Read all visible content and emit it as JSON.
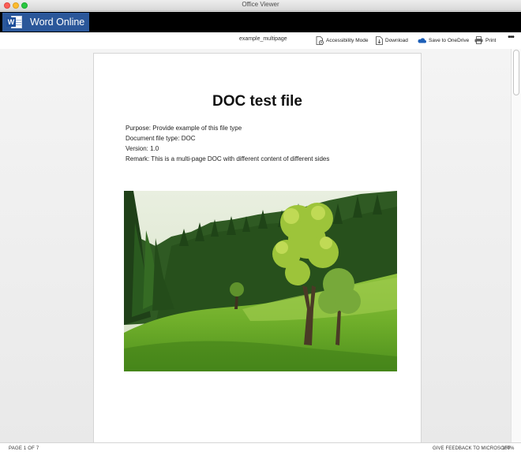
{
  "window": {
    "title": "Office Viewer"
  },
  "app": {
    "brand": "Word Online",
    "icon_letter": "W"
  },
  "toolbar": {
    "document_name": "example_multipage",
    "accessibility": "Accessibility Mode",
    "download": "Download",
    "save_onedrive": "Save to OneDrive",
    "print": "Print",
    "more": "•••"
  },
  "document": {
    "title": "DOC test file",
    "lines": [
      "Purpose: Provide example of this file type",
      "Document file type: DOC",
      "Version: 1.0",
      "Remark: This is a multi-page DOC with different content of different sides"
    ]
  },
  "status": {
    "page": "PAGE 1 OF 7",
    "feedback": "GIVE FEEDBACK TO MICROSOFT",
    "zoom": "100%"
  },
  "colors": {
    "brand_blue": "#2b579a",
    "app_bar": "#000000"
  }
}
